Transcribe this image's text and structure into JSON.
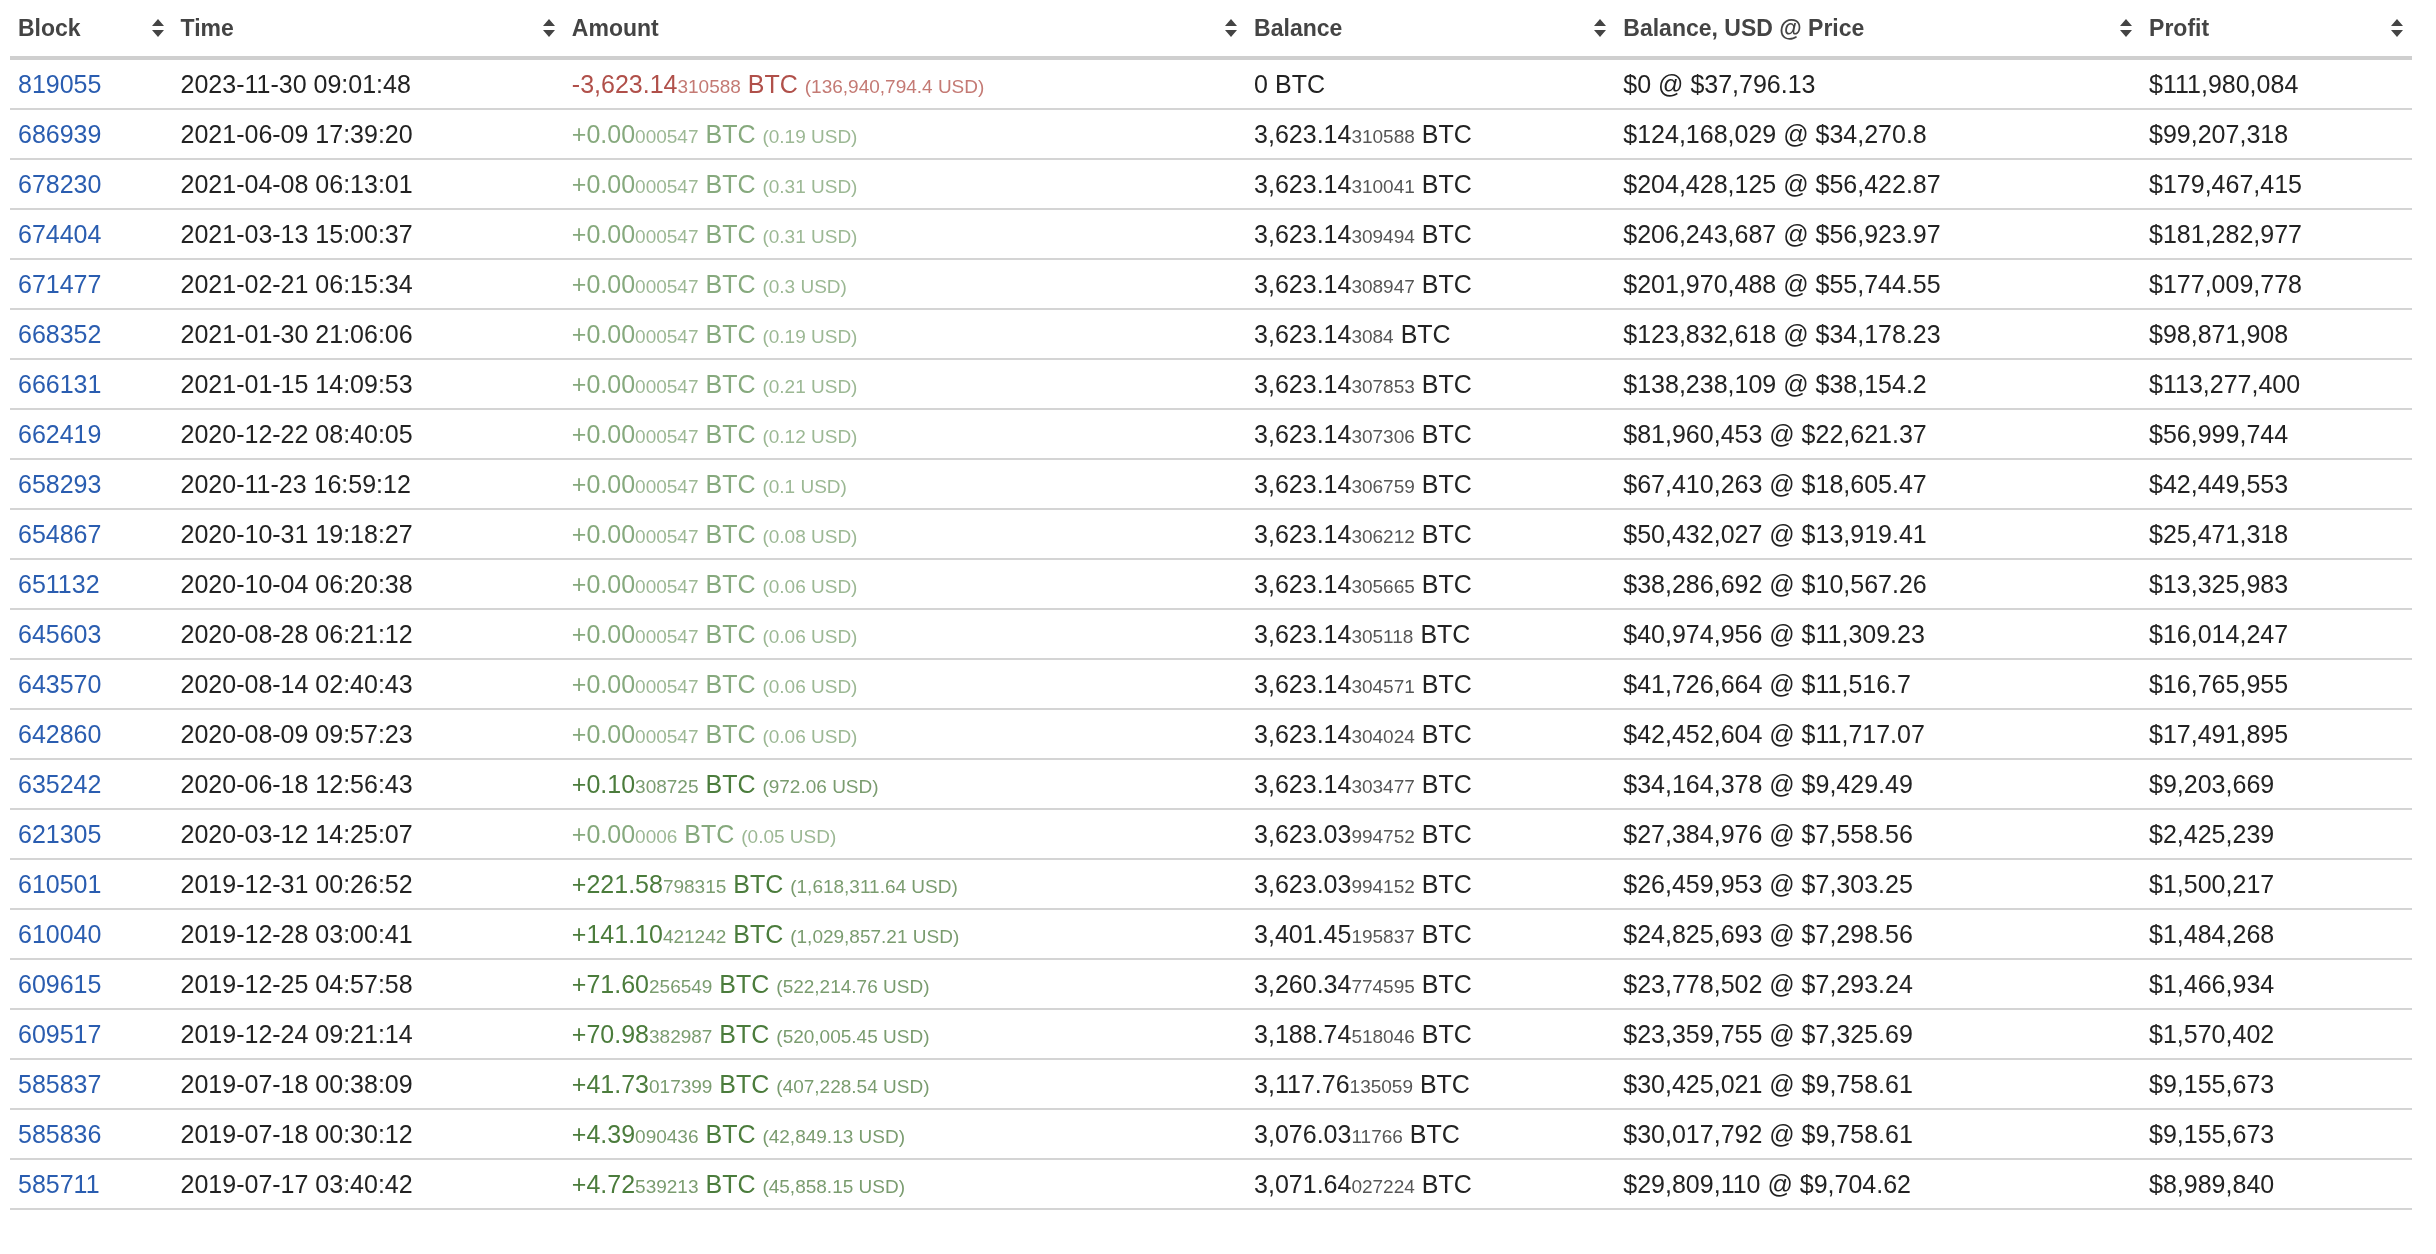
{
  "table": {
    "columns": [
      {
        "label": "Block",
        "sortable": true
      },
      {
        "label": "Time",
        "sortable": true
      },
      {
        "label": "Amount",
        "sortable": true
      },
      {
        "label": "Balance",
        "sortable": true
      },
      {
        "label": "Balance, USD @ Price",
        "sortable": true
      },
      {
        "label": "Profit",
        "sortable": true
      }
    ],
    "rows": [
      {
        "block": "819055",
        "time": "2023-11-30 09:01:48",
        "amount": {
          "kind": "sent",
          "main": "-3,623.14",
          "tail": "310588",
          "unit": "BTC",
          "usd": "(136,940,794.4 USD)"
        },
        "balance": {
          "main": "0",
          "unit": "BTC"
        },
        "balance_usd": "$0 @ $37,796.13",
        "profit": "$111,980,084"
      },
      {
        "block": "686939",
        "time": "2021-06-09 17:39:20",
        "amount": {
          "kind": "dust",
          "main": "+0.00",
          "tail": "000547",
          "unit": "BTC",
          "usd": "(0.19 USD)"
        },
        "balance": {
          "main": "3,623.14",
          "tail": "310588",
          "unit": "BTC"
        },
        "balance_usd": "$124,168,029 @ $34,270.8",
        "profit": "$99,207,318"
      },
      {
        "block": "678230",
        "time": "2021-04-08 06:13:01",
        "amount": {
          "kind": "dust",
          "main": "+0.00",
          "tail": "000547",
          "unit": "BTC",
          "usd": "(0.31 USD)"
        },
        "balance": {
          "main": "3,623.14",
          "tail": "310041",
          "unit": "BTC"
        },
        "balance_usd": "$204,428,125 @ $56,422.87",
        "profit": "$179,467,415"
      },
      {
        "block": "674404",
        "time": "2021-03-13 15:00:37",
        "amount": {
          "kind": "dust",
          "main": "+0.00",
          "tail": "000547",
          "unit": "BTC",
          "usd": "(0.31 USD)"
        },
        "balance": {
          "main": "3,623.14",
          "tail": "309494",
          "unit": "BTC"
        },
        "balance_usd": "$206,243,687 @ $56,923.97",
        "profit": "$181,282,977"
      },
      {
        "block": "671477",
        "time": "2021-02-21 06:15:34",
        "amount": {
          "kind": "dust",
          "main": "+0.00",
          "tail": "000547",
          "unit": "BTC",
          "usd": "(0.3 USD)"
        },
        "balance": {
          "main": "3,623.14",
          "tail": "308947",
          "unit": "BTC"
        },
        "balance_usd": "$201,970,488 @ $55,744.55",
        "profit": "$177,009,778"
      },
      {
        "block": "668352",
        "time": "2021-01-30 21:06:06",
        "amount": {
          "kind": "dust",
          "main": "+0.00",
          "tail": "000547",
          "unit": "BTC",
          "usd": "(0.19 USD)"
        },
        "balance": {
          "main": "3,623.14",
          "tail": "3084",
          "unit": "BTC"
        },
        "balance_usd": "$123,832,618 @ $34,178.23",
        "profit": "$98,871,908"
      },
      {
        "block": "666131",
        "time": "2021-01-15 14:09:53",
        "amount": {
          "kind": "dust",
          "main": "+0.00",
          "tail": "000547",
          "unit": "BTC",
          "usd": "(0.21 USD)"
        },
        "balance": {
          "main": "3,623.14",
          "tail": "307853",
          "unit": "BTC"
        },
        "balance_usd": "$138,238,109 @ $38,154.2",
        "profit": "$113,277,400"
      },
      {
        "block": "662419",
        "time": "2020-12-22 08:40:05",
        "amount": {
          "kind": "dust",
          "main": "+0.00",
          "tail": "000547",
          "unit": "BTC",
          "usd": "(0.12 USD)"
        },
        "balance": {
          "main": "3,623.14",
          "tail": "307306",
          "unit": "BTC"
        },
        "balance_usd": "$81,960,453 @ $22,621.37",
        "profit": "$56,999,744"
      },
      {
        "block": "658293",
        "time": "2020-11-23 16:59:12",
        "amount": {
          "kind": "dust",
          "main": "+0.00",
          "tail": "000547",
          "unit": "BTC",
          "usd": "(0.1 USD)"
        },
        "balance": {
          "main": "3,623.14",
          "tail": "306759",
          "unit": "BTC"
        },
        "balance_usd": "$67,410,263 @ $18,605.47",
        "profit": "$42,449,553"
      },
      {
        "block": "654867",
        "time": "2020-10-31 19:18:27",
        "amount": {
          "kind": "dust",
          "main": "+0.00",
          "tail": "000547",
          "unit": "BTC",
          "usd": "(0.08 USD)"
        },
        "balance": {
          "main": "3,623.14",
          "tail": "306212",
          "unit": "BTC"
        },
        "balance_usd": "$50,432,027 @ $13,919.41",
        "profit": "$25,471,318"
      },
      {
        "block": "651132",
        "time": "2020-10-04 06:20:38",
        "amount": {
          "kind": "dust",
          "main": "+0.00",
          "tail": "000547",
          "unit": "BTC",
          "usd": "(0.06 USD)"
        },
        "balance": {
          "main": "3,623.14",
          "tail": "305665",
          "unit": "BTC"
        },
        "balance_usd": "$38,286,692 @ $10,567.26",
        "profit": "$13,325,983"
      },
      {
        "block": "645603",
        "time": "2020-08-28 06:21:12",
        "amount": {
          "kind": "dust",
          "main": "+0.00",
          "tail": "000547",
          "unit": "BTC",
          "usd": "(0.06 USD)"
        },
        "balance": {
          "main": "3,623.14",
          "tail": "305118",
          "unit": "BTC"
        },
        "balance_usd": "$40,974,956 @ $11,309.23",
        "profit": "$16,014,247"
      },
      {
        "block": "643570",
        "time": "2020-08-14 02:40:43",
        "amount": {
          "kind": "dust",
          "main": "+0.00",
          "tail": "000547",
          "unit": "BTC",
          "usd": "(0.06 USD)"
        },
        "balance": {
          "main": "3,623.14",
          "tail": "304571",
          "unit": "BTC"
        },
        "balance_usd": "$41,726,664 @ $11,516.7",
        "profit": "$16,765,955"
      },
      {
        "block": "642860",
        "time": "2020-08-09 09:57:23",
        "amount": {
          "kind": "dust",
          "main": "+0.00",
          "tail": "000547",
          "unit": "BTC",
          "usd": "(0.06 USD)"
        },
        "balance": {
          "main": "3,623.14",
          "tail": "304024",
          "unit": "BTC"
        },
        "balance_usd": "$42,452,604 @ $11,717.07",
        "profit": "$17,491,895"
      },
      {
        "block": "635242",
        "time": "2020-06-18 12:56:43",
        "amount": {
          "kind": "received",
          "main": "+0.10",
          "tail": "308725",
          "unit": "BTC",
          "usd": "(972.06 USD)"
        },
        "balance": {
          "main": "3,623.14",
          "tail": "303477",
          "unit": "BTC"
        },
        "balance_usd": "$34,164,378 @ $9,429.49",
        "profit": "$9,203,669"
      },
      {
        "block": "621305",
        "time": "2020-03-12 14:25:07",
        "amount": {
          "kind": "dust",
          "main": "+0.00",
          "tail": "0006",
          "unit": "BTC",
          "usd": "(0.05 USD)"
        },
        "balance": {
          "main": "3,623.03",
          "tail": "994752",
          "unit": "BTC"
        },
        "balance_usd": "$27,384,976 @ $7,558.56",
        "profit": "$2,425,239"
      },
      {
        "block": "610501",
        "time": "2019-12-31 00:26:52",
        "amount": {
          "kind": "received",
          "main": "+221.58",
          "tail": "798315",
          "unit": "BTC",
          "usd": "(1,618,311.64 USD)"
        },
        "balance": {
          "main": "3,623.03",
          "tail": "994152",
          "unit": "BTC"
        },
        "balance_usd": "$26,459,953 @ $7,303.25",
        "profit": "$1,500,217"
      },
      {
        "block": "610040",
        "time": "2019-12-28 03:00:41",
        "amount": {
          "kind": "received",
          "main": "+141.10",
          "tail": "421242",
          "unit": "BTC",
          "usd": "(1,029,857.21 USD)"
        },
        "balance": {
          "main": "3,401.45",
          "tail": "195837",
          "unit": "BTC"
        },
        "balance_usd": "$24,825,693 @ $7,298.56",
        "profit": "$1,484,268"
      },
      {
        "block": "609615",
        "time": "2019-12-25 04:57:58",
        "amount": {
          "kind": "received",
          "main": "+71.60",
          "tail": "256549",
          "unit": "BTC",
          "usd": "(522,214.76 USD)"
        },
        "balance": {
          "main": "3,260.34",
          "tail": "774595",
          "unit": "BTC"
        },
        "balance_usd": "$23,778,502 @ $7,293.24",
        "profit": "$1,466,934"
      },
      {
        "block": "609517",
        "time": "2019-12-24 09:21:14",
        "amount": {
          "kind": "received",
          "main": "+70.98",
          "tail": "382987",
          "unit": "BTC",
          "usd": "(520,005.45 USD)"
        },
        "balance": {
          "main": "3,188.74",
          "tail": "518046",
          "unit": "BTC"
        },
        "balance_usd": "$23,359,755 @ $7,325.69",
        "profit": "$1,570,402"
      },
      {
        "block": "585837",
        "time": "2019-07-18 00:38:09",
        "amount": {
          "kind": "received",
          "main": "+41.73",
          "tail": "017399",
          "unit": "BTC",
          "usd": "(407,228.54 USD)"
        },
        "balance": {
          "main": "3,117.76",
          "tail": "135059",
          "unit": "BTC"
        },
        "balance_usd": "$30,425,021 @ $9,758.61",
        "profit": "$9,155,673"
      },
      {
        "block": "585836",
        "time": "2019-07-18 00:30:12",
        "amount": {
          "kind": "received",
          "main": "+4.39",
          "tail": "090436",
          "unit": "BTC",
          "usd": "(42,849.13 USD)"
        },
        "balance": {
          "main": "3,076.03",
          "tail": "11766",
          "unit": "BTC"
        },
        "balance_usd": "$30,017,792 @ $9,758.61",
        "profit": "$9,155,673"
      },
      {
        "block": "585711",
        "time": "2019-07-17 03:40:42",
        "amount": {
          "kind": "received",
          "main": "+4.72",
          "tail": "539213",
          "unit": "BTC",
          "usd": "(45,858.15 USD)"
        },
        "balance": {
          "main": "3,071.64",
          "tail": "027224",
          "unit": "BTC"
        },
        "balance_usd": "$29,809,110 @ $9,704.62",
        "profit": "$8,989,840"
      }
    ]
  }
}
